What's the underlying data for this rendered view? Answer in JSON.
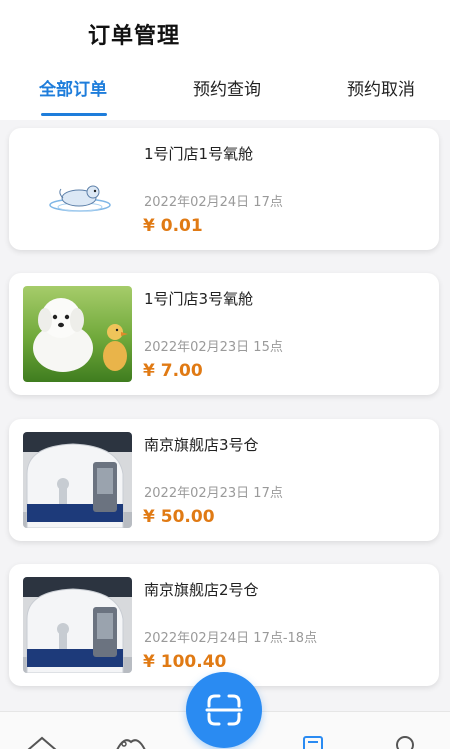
{
  "header": {
    "title": "订单管理"
  },
  "tabs": [
    {
      "label": "全部订单",
      "active": true
    },
    {
      "label": "预约查询",
      "active": false
    },
    {
      "label": "预约取消",
      "active": false
    }
  ],
  "orders": [
    {
      "title": "1号门店1号氧舱",
      "time": "2022年02月24日 17点",
      "price": "¥ 0.01",
      "image": "placeholder-cartoon-icon"
    },
    {
      "title": "1号门店3号氧舱",
      "time": "2022年02月23日 15点",
      "price": "¥ 7.00",
      "image": "puppy-and-duckling-photo"
    },
    {
      "title": "南京旗舰店3号仓",
      "time": "2022年02月23日 17点",
      "price": "¥ 50.00",
      "image": "oxygen-chamber-photo"
    },
    {
      "title": "南京旗舰店2号仓",
      "time": "2022年02月24日 17点-18点",
      "price": "¥ 100.40",
      "image": "oxygen-chamber-photo"
    }
  ],
  "bottom_nav": {
    "items": [
      "home-icon",
      "explore-icon",
      "orders-icon",
      "profile-icon"
    ],
    "center": "scan-icon"
  },
  "colors": {
    "accent": "#1e7ddb",
    "price": "#e07a14",
    "scan": "#2a8bf2"
  }
}
